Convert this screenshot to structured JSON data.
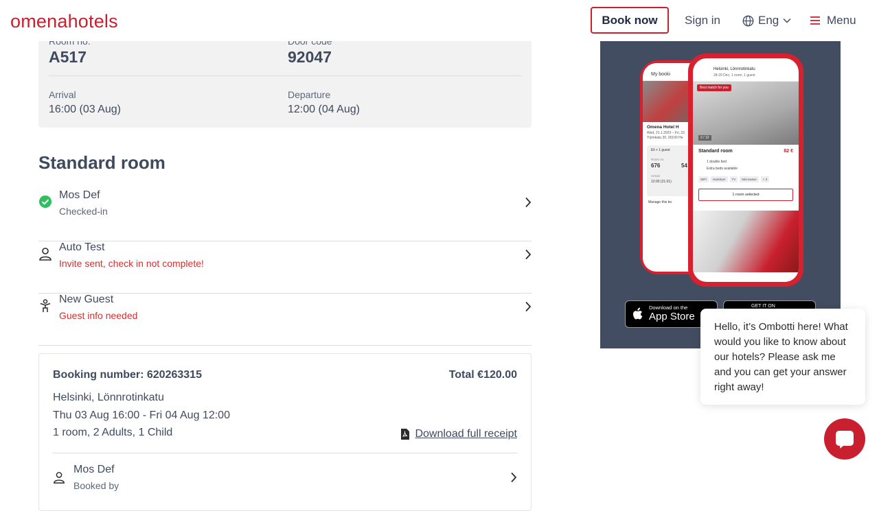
{
  "header": {
    "logo_part1": "omena",
    "logo_part2": "hotels",
    "book_now": "Book now",
    "sign_in": "Sign in",
    "language": "Eng",
    "menu": "Menu"
  },
  "room_info": {
    "room_no_label": "Room no.",
    "room_no": "A517",
    "door_code_label": "Door code",
    "door_code": "92047",
    "arrival_label": "Arrival",
    "arrival": "16:00 (03 Aug)",
    "departure_label": "Departure",
    "departure": "12:00 (04 Aug)"
  },
  "room_type": "Standard room",
  "guests": [
    {
      "name": "Mos Def",
      "status": "Checked-in",
      "status_color": "#5d6677",
      "icon": "check-circle-icon"
    },
    {
      "name": "Auto Test",
      "status": "Invite sent, check in not complete!",
      "status_color": "#d32f2f",
      "icon": "person-icon"
    },
    {
      "name": "New Guest",
      "status": "Guest info needed",
      "status_color": "#d32f2f",
      "icon": "child-icon"
    }
  ],
  "booking": {
    "number_label": "Booking number: 620263315",
    "total": "Total €120.00",
    "location": "Helsinki, Lönnrotinkatu",
    "dates": "Thu 03 Aug 16:00 - Fri 04 Aug 12:00",
    "rooms": "1 room, 2 Adults, 1 Child",
    "receipt_link": "Download full receipt",
    "booker_name": "Mos Def",
    "booker_role": "Booked by"
  },
  "promo": {
    "app_store_small": "Download on the",
    "app_store_big": "App Store",
    "google_small": "GET IT ON",
    "phone_left_title": "My booki",
    "phone_left_hotel": "Omena Hotel H",
    "phone_left_date": "Wed, 21.1.2023 – Fri, 23",
    "phone_left_addr": "Yrjönkatu 30, 00100 He",
    "phone_left_guests": "Eli + 1 guest",
    "phone_left_room_label": "Room no.",
    "phone_left_room": "676",
    "phone_left_door": "54",
    "phone_left_arrival_label": "Arrival",
    "phone_left_arrival": "12:00 (21.01)",
    "phone_left_manage": "Manage this bo",
    "phone_right_title": "Helsinki, Lönnrotinkatu",
    "phone_right_sub": "28-29 Dec, 1 room, 1 guest",
    "phone_right_badge": "Best match for you",
    "phone_right_counter": "2 / 12",
    "phone_right_room": "Standard room",
    "phone_right_price": "82 €",
    "phone_right_bed": "1 double bed",
    "phone_right_extra": "Extra beds available",
    "phone_right_tags": [
      "WiFi",
      "Hairdryer",
      "TV",
      "Microwave",
      "+ 3"
    ],
    "phone_right_selected": "1 room selected"
  },
  "chat": {
    "message": "Hello, it’s Ombotti here! What would you like to know about our hotels? Please ask me and you can get your answer right away!"
  },
  "colors": {
    "brand_red": "#c8202e",
    "text": "#3f4a5e",
    "promo_bg": "#434d61",
    "success": "#2fbf5f",
    "warning": "#d32f2f"
  }
}
